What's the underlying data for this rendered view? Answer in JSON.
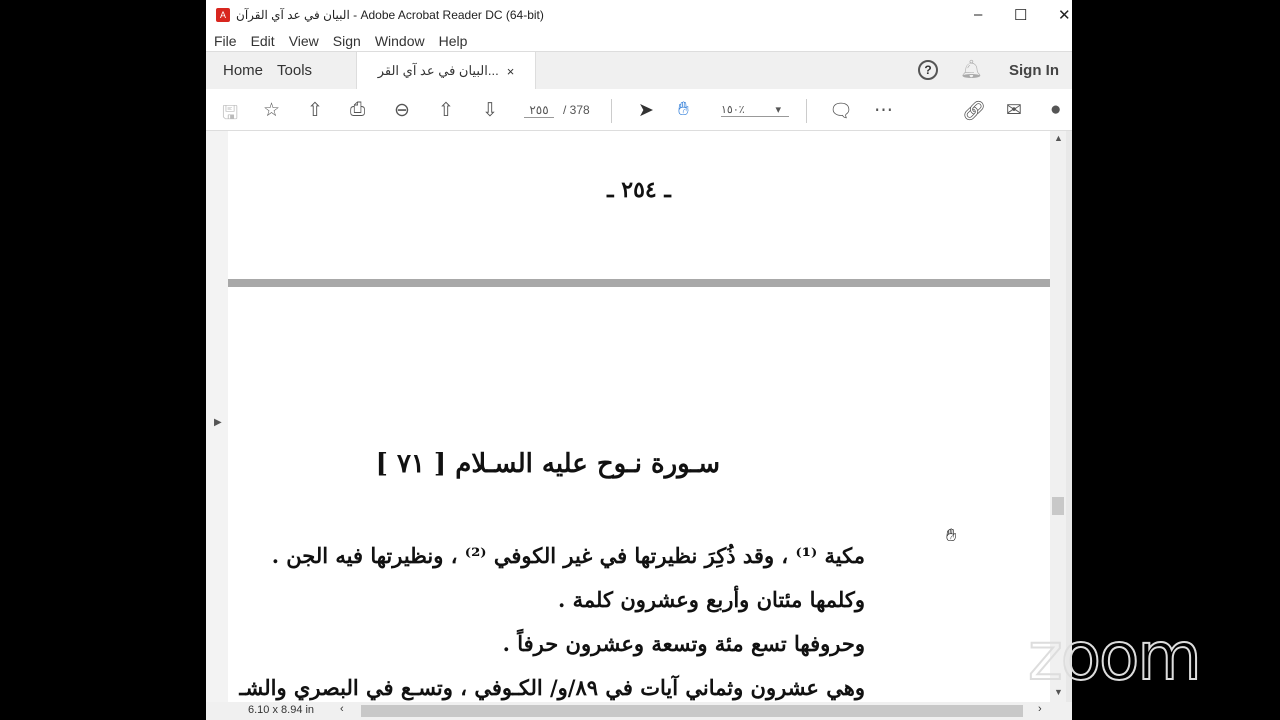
{
  "window": {
    "title": "البيان في عد آي القرآن - Adobe Acrobat Reader DC (64-bit)",
    "minimize": "–",
    "maximize": "☐",
    "close": "✕"
  },
  "menu": [
    "File",
    "Edit",
    "View",
    "Sign",
    "Window",
    "Help"
  ],
  "tabs": {
    "home": "Home",
    "tools": "Tools",
    "doc": "البيان في عد آي القر...",
    "close": "×",
    "help": "?",
    "signin": "Sign In"
  },
  "toolbar": {
    "page_current": "٢٥٥",
    "page_total": "/ 378",
    "zoom": "١٥٠٪"
  },
  "document": {
    "page_number": "ـ ٢٥٤ ـ",
    "heading": "سـورة نـوح عليه السـلام [ ٧١ ]",
    "lines": [
      "مكية ⁽¹⁾ ، وقد ذُكِرَ نظيرتها في غير الكوفي ⁽²⁾ ، ونظيرتها فيه الجن .",
      "وكلمها مئتان وأربع وعشرون كلمة .",
      "وحروفها تسع مئة وتسعة وعشرون حرفاً .",
      "وهي عشرون وثماني آيات في ٨٩/و/ الكـوفي ، وتسـع في البصري والشـ"
    ]
  },
  "status": {
    "page_size": "6.10 x 8.94 in"
  },
  "watermark": "zoom"
}
